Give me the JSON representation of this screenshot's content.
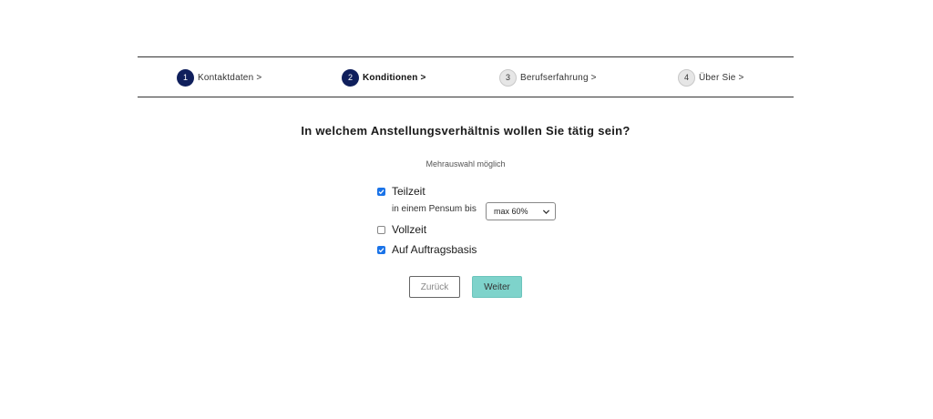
{
  "stepper": {
    "steps": [
      {
        "number": "1",
        "label": "Kontaktdaten >",
        "state": "done"
      },
      {
        "number": "2",
        "label": "Konditionen >",
        "state": "active"
      },
      {
        "number": "3",
        "label": "Berufserfahrung >",
        "state": "todo"
      },
      {
        "number": "4",
        "label": "Über Sie >",
        "state": "todo"
      }
    ]
  },
  "form": {
    "question": "In welchem Anstellungsverhältnis wollen Sie tätig sein?",
    "hint": "Mehrauswahl möglich",
    "options": [
      {
        "label": "Teilzeit",
        "checked": true
      },
      {
        "label": "Vollzeit",
        "checked": false
      },
      {
        "label": "Auf Auftragsbasis",
        "checked": true
      }
    ],
    "pensum": {
      "label": "in einem Pensum bis",
      "selected": "max 60%"
    }
  },
  "buttons": {
    "back": "Zurück",
    "next": "Weiter"
  },
  "colors": {
    "accent": "#0f1f5c",
    "checkbox": "#1a73e8",
    "primary_button": "#7ed3cb"
  }
}
